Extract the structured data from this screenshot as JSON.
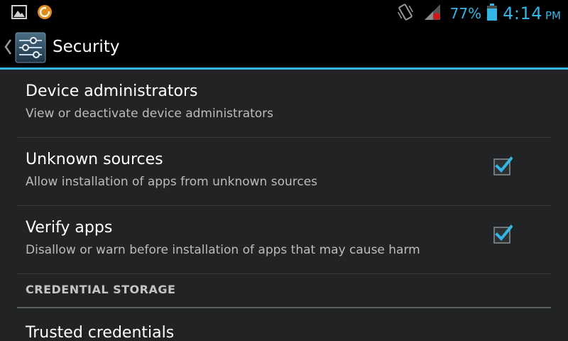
{
  "status_bar": {
    "left_icons": [
      "gallery-icon",
      "download-badge-icon"
    ],
    "right_icons": [
      "vibrate-icon",
      "signal-icon",
      "battery-icon"
    ],
    "battery_percent": "77%",
    "time": "4:14",
    "ampm": "PM",
    "accent_color": "#33b5e5"
  },
  "action_bar": {
    "title": "Security",
    "up_icon": "chevron-left-icon",
    "app_icon": "settings-sliders-icon"
  },
  "items": [
    {
      "title": "Device administrators",
      "summary": "View or deactivate device administrators",
      "has_checkbox": false
    },
    {
      "title": "Unknown sources",
      "summary": "Allow installation of apps from unknown sources",
      "has_checkbox": true,
      "checked": true
    },
    {
      "title": "Verify apps",
      "summary": "Disallow or warn before installation of apps that may cause harm",
      "has_checkbox": true,
      "checked": true
    }
  ],
  "category": {
    "label": "CREDENTIAL STORAGE"
  },
  "partial_item": {
    "title": "Trusted credentials"
  }
}
